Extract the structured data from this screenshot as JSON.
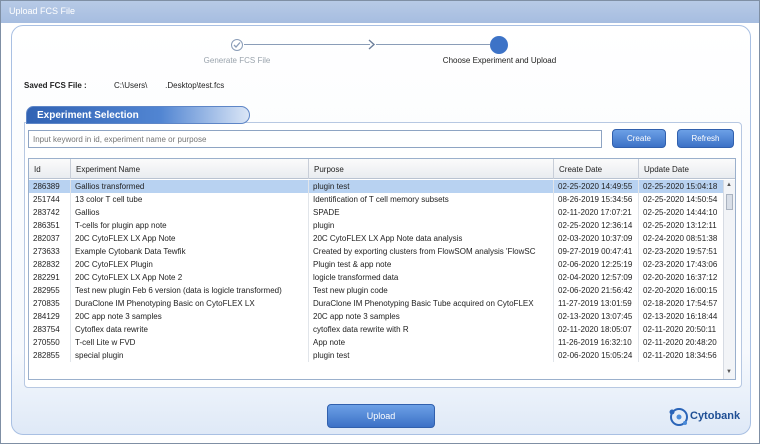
{
  "window": {
    "title": "Upload FCS File"
  },
  "steps": [
    {
      "label": "Generate FCS File",
      "state": "done"
    },
    {
      "label": "Choose Experiment and Upload",
      "state": "active"
    }
  ],
  "saved": {
    "label": "Saved FCS File :",
    "value": "C:\\Users\\        .Desktop\\test.fcs"
  },
  "section": {
    "title": "Experiment Selection"
  },
  "search": {
    "placeholder": "Input keyword in id, experiment name or purpose"
  },
  "buttons": {
    "create": "Create",
    "refresh": "Refresh",
    "upload": "Upload"
  },
  "table": {
    "columns": [
      "Id",
      "Experiment Name",
      "Purpose",
      "Create Date",
      "Update Date"
    ],
    "selected_row": 0,
    "rows": [
      [
        "286389",
        "Gallios transformed",
        "plugin test",
        "02-25-2020 14:49:55",
        "02-25-2020 15:04:18"
      ],
      [
        "251744",
        "13 color T cell tube",
        "Identification of T cell memory subsets",
        "08-26-2019 15:34:56",
        "02-25-2020 14:50:54"
      ],
      [
        "283742",
        "Gallios",
        "SPADE",
        "02-11-2020 17:07:21",
        "02-25-2020 14:44:10"
      ],
      [
        "286351",
        "T-cells for plugin app note",
        "plugin",
        "02-25-2020 12:36:14",
        "02-25-2020 13:12:11"
      ],
      [
        "282037",
        "20C CytoFLEX LX App Note",
        "20C CytoFLEX LX App Note data analysis",
        "02-03-2020 10:37:09",
        "02-24-2020 08:51:38"
      ],
      [
        "273633",
        "Example Cytobank Data Tewfik",
        "Created by exporting clusters from FlowSOM analysis 'FlowSC",
        "09-27-2019 00:47:41",
        "02-23-2020 19:57:51"
      ],
      [
        "282832",
        "20C CytoFLEX Plugin",
        "Plugin test & app note",
        "02-06-2020 12:25:19",
        "02-23-2020 17:43:06"
      ],
      [
        "282291",
        "20C CytoFLEX LX App Note 2",
        "logicle transformed data",
        "02-04-2020 12:57:09",
        "02-20-2020 16:37:12"
      ],
      [
        "282955",
        "Test new plugin Feb 6 version (data is logicle transformed)",
        "Test new plugin code",
        "02-06-2020 21:56:42",
        "02-20-2020 16:00:15"
      ],
      [
        "270835",
        "DuraClone IM Phenotyping Basic on CytoFLEX LX",
        "DuraClone IM Phenotyping Basic Tube acquired on CytoFLEX",
        "11-27-2019 13:01:59",
        "02-18-2020 17:54:57"
      ],
      [
        "284129",
        "20C app note 3 samples",
        "20C app note 3 samples",
        "02-13-2020 13:07:45",
        "02-13-2020 16:18:44"
      ],
      [
        "283754",
        "Cytoflex data rewrite",
        "cytoflex data rewrite with R",
        "02-11-2020 18:05:07",
        "02-11-2020 20:50:11"
      ],
      [
        "270550",
        "T-cell Lite w FVD",
        "App note",
        "11-26-2019 16:32:10",
        "02-11-2020 20:48:20"
      ],
      [
        "282855",
        "special plugin",
        "plugin test",
        "02-06-2020 15:05:24",
        "02-11-2020 18:34:56"
      ]
    ]
  },
  "logo": {
    "text": "Cytobank"
  },
  "colors": {
    "accent": "#3d73c7",
    "selected_row": "#b8d2f1",
    "title_bar": "#a6bde0"
  }
}
